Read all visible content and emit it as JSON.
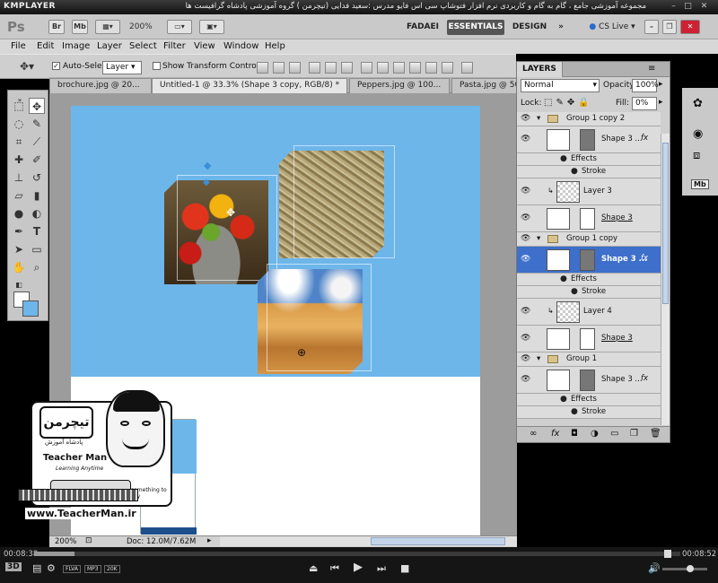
{
  "player": {
    "logo": "KMPLAYER",
    "title": "مجموعه آموزشی جامع ، گام به گام و کاربردی نرم افزار فتوشاپ سی اس فایو  مدرس :سعید فدایی (تیچرمن ) گروه آموزشی پادشاه گرافیست ها",
    "elapsed": "00:08:38",
    "total": "00:08:52",
    "labels": [
      "FLVA",
      "MP3",
      "20K"
    ]
  },
  "app": {
    "logo": "Ps",
    "bridge": "Br",
    "minibridge": "Mb",
    "zoom": "200%",
    "workspaces": [
      "FADAEI",
      "ESSENTIALS",
      "DESIGN"
    ],
    "cslive": "CS Live"
  },
  "menu": [
    "File",
    "Edit",
    "Image",
    "Layer",
    "Select",
    "Filter",
    "View",
    "Window",
    "Help"
  ],
  "options": {
    "auto_select_label": "Auto-Select:",
    "auto_select_value": "Layer",
    "show_transform": "Show Transform Controls"
  },
  "tabs": [
    "brochure.jpg @ 20...",
    "Untitled-1 @ 33.3% (Shape 3 copy, RGB/8) *",
    "Peppers.jpg @ 100...",
    "Pasta.jpg @ 50"
  ],
  "status": {
    "zoom": "200%",
    "doc": "Doc: 12.0M/7.62M"
  },
  "layers_panel": {
    "title": "LAYERS",
    "blend": "Normal",
    "opacity_label": "Opacity:",
    "opacity": "100%",
    "lock_label": "Lock:",
    "fill_label": "Fill:",
    "fill": "0%",
    "rows": [
      {
        "kind": "group",
        "name": "Group 1 copy 2"
      },
      {
        "kind": "shape",
        "name": "Shape 3 ..."
      },
      {
        "kind": "effects",
        "name": "Effects"
      },
      {
        "kind": "effect",
        "name": "Stroke"
      },
      {
        "kind": "image",
        "name": "Layer 3"
      },
      {
        "kind": "shape",
        "name": "Shape 3"
      },
      {
        "kind": "group",
        "name": "Group 1 copy"
      },
      {
        "kind": "shape-selected",
        "name": "Shape 3 ..."
      },
      {
        "kind": "effects",
        "name": "Effects"
      },
      {
        "kind": "effect",
        "name": "Stroke"
      },
      {
        "kind": "image",
        "name": "Layer 4"
      },
      {
        "kind": "shape",
        "name": "Shape 3"
      },
      {
        "kind": "group",
        "name": "Group 1"
      },
      {
        "kind": "shape",
        "name": "Shape 3 ..."
      },
      {
        "kind": "effects",
        "name": "Effects"
      },
      {
        "kind": "effect",
        "name": "Stroke"
      }
    ],
    "fx": "fx"
  },
  "watermark": {
    "site": "www.TeacherMan.ir",
    "brand": "Teacher Man",
    "sub": "Learning Anytime",
    "bubble": "something to say",
    "logo_fa": "تیچرمن",
    "tagline_fa": "پادشاه آموزش"
  },
  "colors": {
    "canvas_blue": "#6db6ea",
    "selection": "#3d6fcb"
  }
}
